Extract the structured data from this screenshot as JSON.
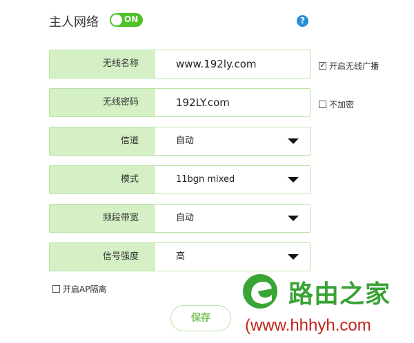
{
  "header": {
    "title": "主人网络",
    "toggle_label": "ON",
    "help_symbol": "?"
  },
  "fields": [
    {
      "label": "无线名称",
      "value": "www.192ly.com"
    },
    {
      "label": "无线密码",
      "value": "192LY.com"
    },
    {
      "label": "信道",
      "value": "自动"
    },
    {
      "label": "模式",
      "value": "11bgn mixed"
    },
    {
      "label": "频段带宽",
      "value": "自动"
    },
    {
      "label": "信号强度",
      "value": "高"
    }
  ],
  "options": {
    "broadcast_label": "开启无线广播",
    "broadcast_checked": true,
    "no_encrypt_label": "不加密",
    "no_encrypt_checked": false,
    "ap_isolation_label": "开启AP隔离",
    "ap_isolation_checked": false,
    "check_mark": "✓"
  },
  "actions": {
    "save_label": "保存"
  },
  "watermark": {
    "brand": "路由之家",
    "url": "(www.hhhyh.com"
  },
  "colors": {
    "accent": "#4fc22a",
    "label_bg": "#d4f0c4",
    "border": "#b9e4a8",
    "help": "#2a8fd9"
  }
}
